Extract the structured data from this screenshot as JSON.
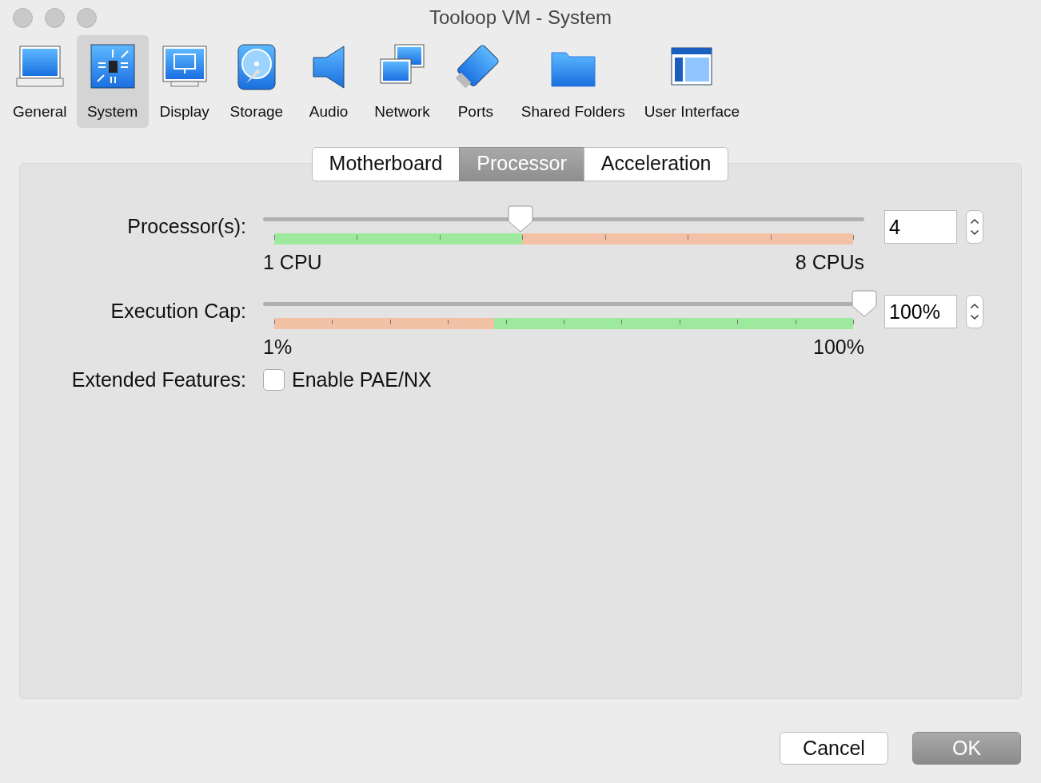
{
  "window": {
    "title": "Tooloop VM - System"
  },
  "toolbar": [
    {
      "label": "General",
      "selected": false
    },
    {
      "label": "System",
      "selected": true
    },
    {
      "label": "Display",
      "selected": false
    },
    {
      "label": "Storage",
      "selected": false
    },
    {
      "label": "Audio",
      "selected": false
    },
    {
      "label": "Network",
      "selected": false
    },
    {
      "label": "Ports",
      "selected": false
    },
    {
      "label": "Shared Folders",
      "selected": false
    },
    {
      "label": "User Interface",
      "selected": false
    }
  ],
  "tabs": [
    {
      "label": "Motherboard",
      "selected": false
    },
    {
      "label": "Processor",
      "selected": true
    },
    {
      "label": "Acceleration",
      "selected": false
    }
  ],
  "sliders": [
    {
      "kind": "cpu",
      "label": "Processor(s):",
      "level": 0.4286,
      "min_label": "1 CPU",
      "max_label": "8 CPUs",
      "value": "4"
    },
    {
      "kind": "cap",
      "label": "Execution Cap:",
      "level": 1.0,
      "min_label": "1%",
      "max_label": "100%",
      "value": "100%"
    }
  ],
  "extended_features": {
    "label": "Extended Features:",
    "checkbox": {
      "label": "Enable PAE/NX",
      "checked": false
    }
  },
  "buttons": [
    {
      "label": "Cancel",
      "kind": "default"
    },
    {
      "label": "OK",
      "kind": "primary"
    }
  ]
}
